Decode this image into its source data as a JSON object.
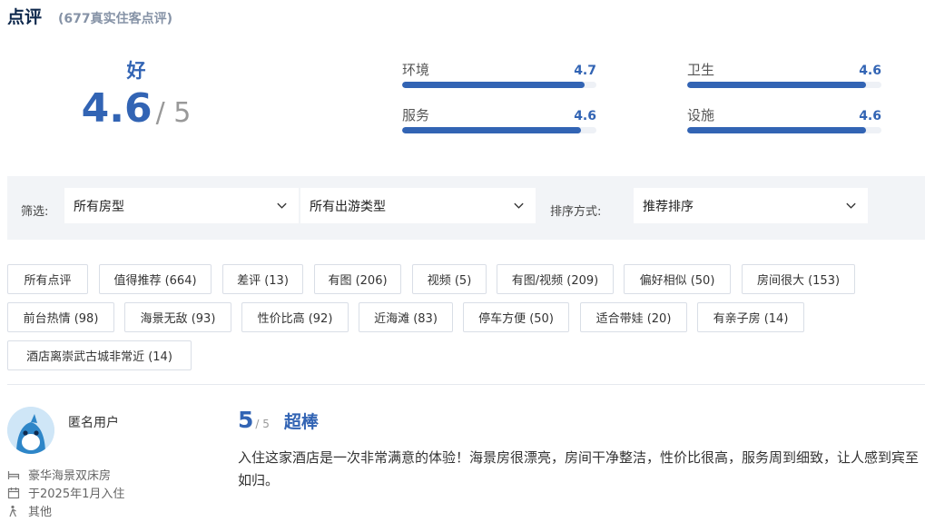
{
  "header": {
    "title": "点评",
    "count": "(677真实住客点评)"
  },
  "overall": {
    "level": "好",
    "score": "4.6",
    "out_of": "/ 5"
  },
  "sub_scores": [
    {
      "name": "环境",
      "value": "4.7",
      "fraction": 0.94
    },
    {
      "name": "卫生",
      "value": "4.6",
      "fraction": 0.92
    },
    {
      "name": "服务",
      "value": "4.6",
      "fraction": 0.92
    },
    {
      "name": "设施",
      "value": "4.6",
      "fraction": 0.92
    }
  ],
  "filters": {
    "filter_label": "筛选:",
    "room_type": "所有房型",
    "trip_type": "所有出游类型",
    "sort_label": "排序方式:",
    "sort_value": "推荐排序"
  },
  "tags": [
    "所有点评",
    "值得推荐 (664)",
    "差评 (13)",
    "有图 (206)",
    "视频 (5)",
    "有图/视频 (209)",
    "偏好相似 (50)",
    "房间很大 (153)",
    "前台热情 (98)",
    "海景无敌 (93)",
    "性价比高 (92)",
    "近海滩 (83)",
    "停车方便 (50)",
    "适合带娃 (20)",
    "有亲子房 (14)",
    "酒店离崇武古城非常近 (14)"
  ],
  "review": {
    "user": "匿名用户",
    "room": "豪华海景双床房",
    "checkin": "于2025年1月入住",
    "trip": "其他",
    "score": "5",
    "out_of": "/ 5",
    "verdict": "超棒",
    "text": "入住这家酒店是一次非常满意的体验！海景房很漂亮，房间干净整洁，性价比很高，服务周到细致，让人感到宾至如归。"
  },
  "colors": {
    "accent": "#3264b4",
    "title": "#0f294d"
  }
}
